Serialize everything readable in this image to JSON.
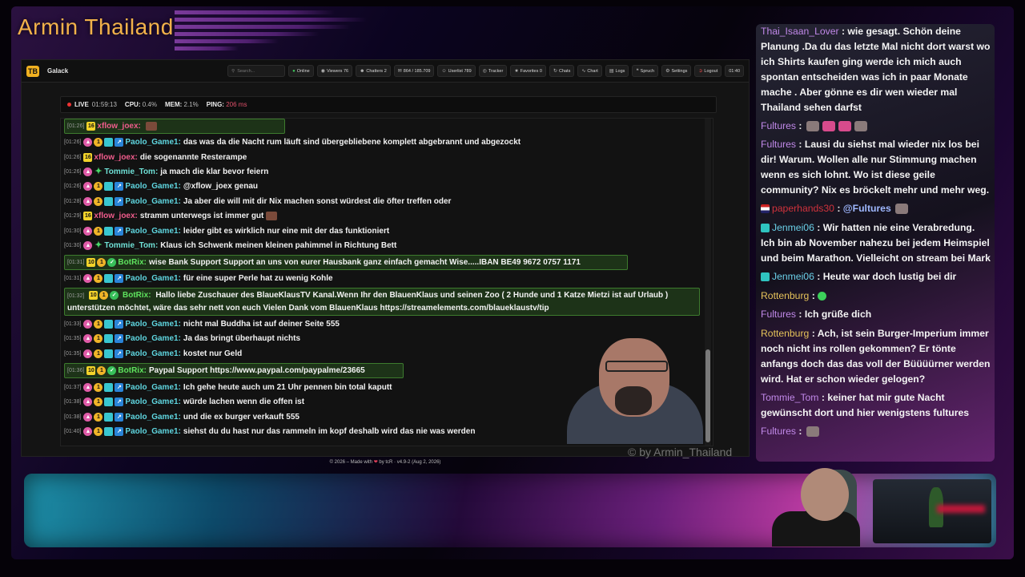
{
  "overlay": {
    "brand_title": "Armin Thailand",
    "watermark": "© by Armin_Thailand"
  },
  "app": {
    "name": "Galack",
    "logo_text": "TB",
    "search_placeholder": "Search...",
    "toolbar": {
      "online": "Online",
      "viewers": "Viewers 76",
      "chatters": "Chatters 2",
      "messages": "864 / 185.709",
      "userlist": "Userlist 789",
      "tracker": "Tracker",
      "favorites": "Favorites 0",
      "chats": "Chats",
      "chart": "Chart",
      "logs": "Logs",
      "spruch": "Spruch",
      "settings": "Settings",
      "logout": "Logout",
      "clock": "01:40"
    },
    "status": {
      "live_label": "LIVE",
      "live_time": "01:59:13",
      "cpu_label": "CPU:",
      "cpu_value": "0.4%",
      "mem_label": "MEM:",
      "mem_value": "2.1%",
      "ping_label": "PING:",
      "ping_value": "206 ms"
    },
    "messages": [
      {
        "ts": "[01:26]",
        "user": "xflow_joex:",
        "text": ""
      },
      {
        "ts": "[01:26]",
        "user": "Paolo_Game1:",
        "text": "das was da die Nacht rum läuft sind übergebliebene komplett abgebrannt und abgezockt"
      },
      {
        "ts": "[01:26]",
        "user": "xflow_joex:",
        "text": "die sogenannte Resterampe"
      },
      {
        "ts": "[01:26]",
        "user": "Tommie_Tom:",
        "text": "ja mach die klar bevor feiern"
      },
      {
        "ts": "[01:26]",
        "user": "Paolo_Game1:",
        "text": "@xflow_joex genau"
      },
      {
        "ts": "[01:28]",
        "user": "Paolo_Game1:",
        "text": "Ja aber die will mit dir Nix machen sonst würdest die öfter treffen oder"
      },
      {
        "ts": "[01:29]",
        "user": "xflow_joex:",
        "text": "stramm unterwegs ist immer gut"
      },
      {
        "ts": "[01:30]",
        "user": "Paolo_Game1:",
        "text": "leider gibt es wirklich nur eine mit der das funktioniert"
      },
      {
        "ts": "[01:30]",
        "user": "Tommie_Tom:",
        "text": "Klaus ich Schwenk meinen kleinen pahimmel in Richtung Bett"
      },
      {
        "ts": "[01:31]",
        "user": "BotRix:",
        "text": "wise Bank Support Support an uns von eurer Hausbank ganz einfach gemacht Wise.....IBAN BE49 9672 0757 1171"
      },
      {
        "ts": "[01:31]",
        "user": "Paolo_Game1:",
        "text": "für eine super Perle hat zu wenig Kohle"
      },
      {
        "ts": "[01:32]",
        "user": "BotRix:",
        "text": "Hallo liebe Zuschauer des BlaueKlausTV Kanal.Wenn Ihr den BlauenKlaus und seinen Zoo ( 2 Hunde und 1 Katze Mietzi ist auf Urlaub ) unterstützen möchtet, wäre das sehr nett von euch Vielen Dank vom BlauenKlaus https://streamelements.com/blaueklaustv/tip"
      },
      {
        "ts": "[01:33]",
        "user": "Paolo_Game1:",
        "text": "nicht mal Buddha ist auf deiner Seite 555"
      },
      {
        "ts": "[01:35]",
        "user": "Paolo_Game1:",
        "text": "Ja das bringt überhaupt nichts"
      },
      {
        "ts": "[01:35]",
        "user": "Paolo_Game1:",
        "text": "kostet nur Geld"
      },
      {
        "ts": "[01:36]",
        "user": "BotRix:",
        "text": "Paypal Support https://www.paypal.com/paypalme/23665"
      },
      {
        "ts": "[01:37]",
        "user": "Paolo_Game1:",
        "text": "Ich gehe heute auch um 21 Uhr pennen bin total kaputt"
      },
      {
        "ts": "[01:38]",
        "user": "Paolo_Game1:",
        "text": "würde lachen wenn die offen ist"
      },
      {
        "ts": "[01:38]",
        "user": "Paolo_Game1:",
        "text": "und die ex burger verkauft 555"
      },
      {
        "ts": "[01:40]",
        "user": "Paolo_Game1:",
        "text": "siehst du du hast nur das rammeln im kopf deshalb wird das nie was werden"
      }
    ],
    "footer": {
      "prefix": "© 2026 – Made with",
      "suffix": "by tcR · v4.9-2 (Aug 2, 2026)"
    }
  },
  "side_chat": [
    {
      "user": "Thai_Isaan_Lover",
      "sep": " : ",
      "text": "wie gesagt. Schön deine Planung .Da du das letzte Mal nicht dort warst wo ich Shirts kaufen ging werde ich mich auch spontan entscheiden was ich in paar Monate mache . Aber gönne es dir wen wieder mal Thailand sehen darfst"
    },
    {
      "user": "Fultures",
      "sep": " : ",
      "text": ""
    },
    {
      "user": "Fultures",
      "sep": " : ",
      "text": "Lausi du siehst mal wieder nix los bei dir! Warum. Wollen alle nur Stimmung machen wenn es sich lohnt. Wo ist diese geile community? Nix es bröckelt mehr und mehr weg."
    },
    {
      "user": "paperhands30",
      "sep": " : ",
      "text": "@Fultures"
    },
    {
      "user": "Jenmei06",
      "sep": " : ",
      "text": "Wir hatten nie eine Verabredung. Ich bin ab November nahezu bei jedem Heimspiel und beim Marathon. Vielleicht on stream bei Mark"
    },
    {
      "user": "Jenmei06",
      "sep": " : ",
      "text": "Heute war doch lustig bei dir"
    },
    {
      "user": "Rottenburg",
      "sep": " : ",
      "text": ""
    },
    {
      "user": "Fultures",
      "sep": " : ",
      "text": "Ich grüße dich"
    },
    {
      "user": "Rottenburg",
      "sep": " : ",
      "text": "Ach, ist sein Burger-Imperium immer noch nicht ins rollen gekommen? Er tönte anfangs doch das das voll der Büüüürner werden wird. Hat er schon wieder gelogen?"
    },
    {
      "user": "Tommie_Tom",
      "sep": " : ",
      "text": "keiner hat mir gute Nacht gewünscht dort und hier wenigstens fultures"
    },
    {
      "user": "Fultures",
      "sep": " : ",
      "text": ""
    }
  ]
}
